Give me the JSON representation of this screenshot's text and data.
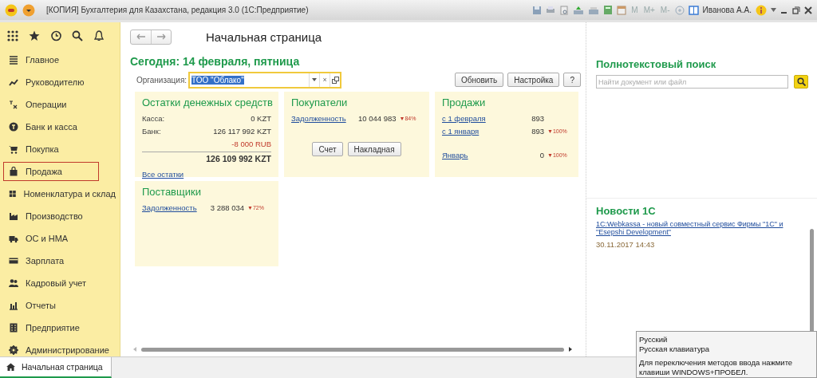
{
  "window": {
    "title": "[КОПИЯ] Бухгалтерия для Казахстана, редакция 3.0  (1С:Предприятие)",
    "memory_buttons": [
      "M",
      "M+",
      "M-"
    ],
    "user": "Иванова А.А."
  },
  "sidebar": {
    "items": [
      {
        "label": "Главное",
        "selected": false
      },
      {
        "label": "Руководителю",
        "selected": false
      },
      {
        "label": "Операции",
        "selected": false
      },
      {
        "label": "Банк и касса",
        "selected": false
      },
      {
        "label": "Покупка",
        "selected": false
      },
      {
        "label": "Продажа",
        "selected": true
      },
      {
        "label": "Номенклатура и склад",
        "selected": false
      },
      {
        "label": "Производство",
        "selected": false
      },
      {
        "label": "ОС и НМА",
        "selected": false
      },
      {
        "label": "Зарплата",
        "selected": false
      },
      {
        "label": "Кадровый учет",
        "selected": false
      },
      {
        "label": "Отчеты",
        "selected": false
      },
      {
        "label": "Предприятие",
        "selected": false
      },
      {
        "label": "Администрирование",
        "selected": false
      }
    ]
  },
  "page": {
    "title": "Начальная страница",
    "today": "Сегодня: 14 февраля, пятница",
    "organization": {
      "label": "Организация:",
      "value": "ТОО \"Облако\"",
      "clear": "×"
    },
    "buttons": [
      "Обновить",
      "Настройка",
      "?"
    ],
    "cards": [
      {
        "title": "Остатки денежных средств",
        "rows": [
          {
            "kind": "field",
            "label": "Касса:",
            "value": "0 KZT"
          },
          {
            "kind": "field",
            "label": "Банк:",
            "value": "126 117 992 KZT"
          },
          {
            "kind": "negative",
            "value": "-8 000 RUB"
          },
          {
            "kind": "total",
            "value": "126 109 992 KZT"
          },
          {
            "kind": "footer",
            "label": "Все остатки"
          }
        ]
      },
      {
        "title": "Покупатели",
        "rows": [
          {
            "kind": "link",
            "label": "Задолженность",
            "value": "10 044 983",
            "change": "▼84%"
          },
          {
            "kind": "buttons",
            "buttons": [
              "Счет",
              "Накладная"
            ]
          }
        ]
      },
      {
        "title": "Продажи",
        "rows": [
          {
            "kind": "stat",
            "label": "с 1 февраля",
            "value": "893"
          },
          {
            "kind": "stat",
            "label": "с 1 января",
            "value": "893",
            "change": "▼100%"
          },
          {
            "kind": "spacer"
          },
          {
            "kind": "stat",
            "label": "Январь",
            "value": "0",
            "change": "▼100%"
          }
        ]
      },
      {
        "title": "Поставщики",
        "rows": [
          {
            "kind": "link",
            "label": "Задолженность",
            "value": "3 288 034",
            "change": "▼72%"
          }
        ]
      }
    ]
  },
  "search": {
    "title": "Полнотекстовый поиск",
    "placeholder": "Найти документ или файл"
  },
  "news": {
    "title": "Новости 1С",
    "items": [
      {
        "link": "1С:Webkassa - новый совместный сервис Фирмы \"1С\" и \"Esepshi Development\"",
        "date": "30.11.2017 14:43"
      }
    ]
  },
  "bottom_tabs": [
    {
      "label": "Начальная страница",
      "selected": true
    }
  ],
  "language_popup": {
    "lines": [
      "Русский",
      "Русская клавиатура",
      "Для переключения методов ввода нажмите клавиши WINDOWS+ПРОБЕЛ."
    ]
  }
}
